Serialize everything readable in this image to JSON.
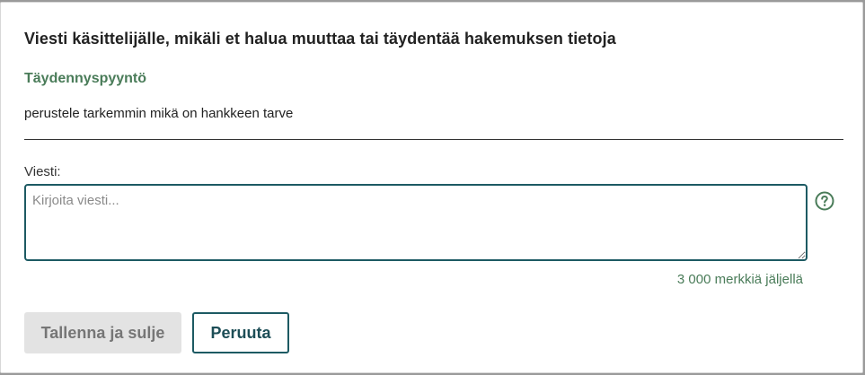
{
  "dialog": {
    "title": "Viesti käsittelijälle, mikäli et halua muuttaa tai täydentää hakemuksen tietoja",
    "section_title": "Täydennyspyyntö",
    "request_text": "perustele tarkemmin mikä on hankkeen tarve",
    "message_label": "Viesti:",
    "message_value": "",
    "message_placeholder": "Kirjoita viesti...",
    "help_icon": "question-circle-icon",
    "char_counter": "3 000 merkkiä jäljellä",
    "save_label": "Tallenna ja sulje",
    "cancel_label": "Peruuta"
  },
  "colors": {
    "accent": "#4a7c59",
    "primary_border": "#1d5a63",
    "disabled_bg": "#e3e3e3"
  }
}
